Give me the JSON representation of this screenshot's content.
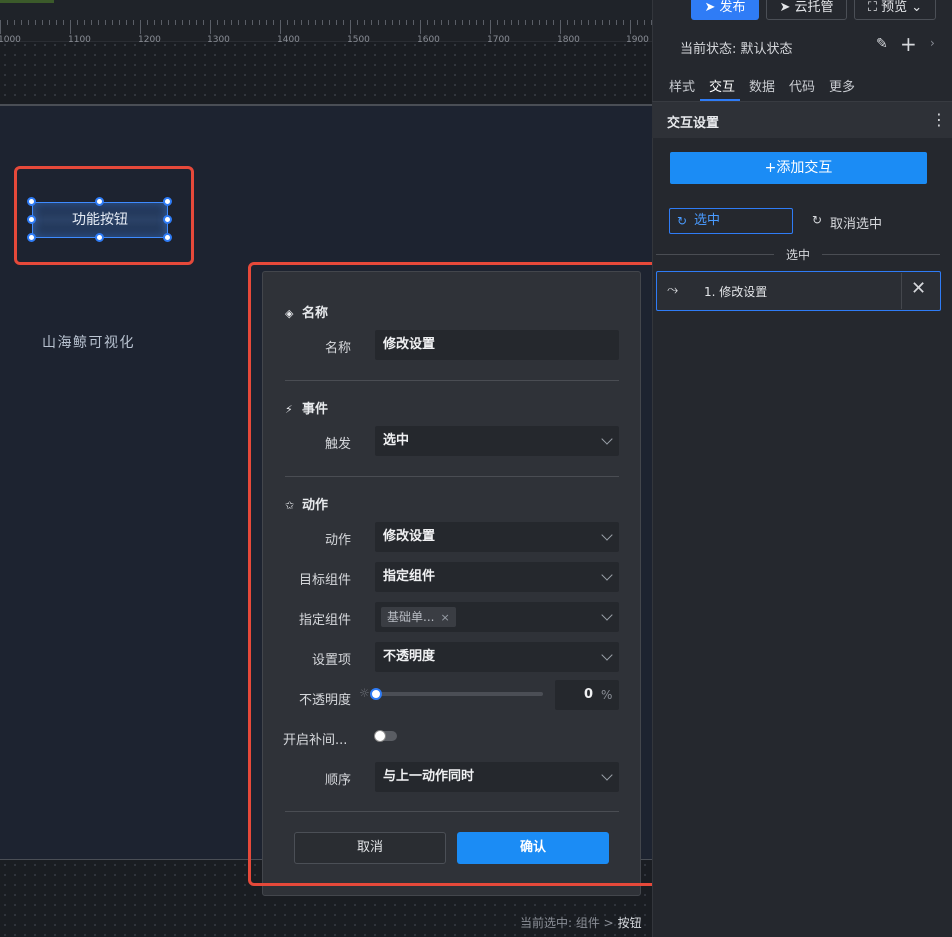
{
  "ruler": {
    "ticks": [
      "1000",
      "1100",
      "1200",
      "1300",
      "1400",
      "1500",
      "1600",
      "1700",
      "1800",
      "1900"
    ]
  },
  "canvas": {
    "button_label": "功能按钮",
    "brand_text": "山海鲸可视化",
    "selection_prefix": "当前选中: 组件 >",
    "selection_current": "按钮"
  },
  "toolbar": {
    "publish_label": "发布",
    "cloud_label": "云托管",
    "preview_label": "预览"
  },
  "panel": {
    "state_label": "当前状态:  默认状态",
    "tabs": [
      {
        "label": "样式"
      },
      {
        "label": "交互"
      },
      {
        "label": "数据"
      },
      {
        "label": "代码"
      },
      {
        "label": "更多"
      }
    ],
    "active_tab": "交互",
    "section_title": "交互设置",
    "add_button": "+添加交互",
    "option_select": "选中",
    "option_deselect": "取消选中",
    "group_label": "选中",
    "action_item": "1. 修改设置"
  },
  "dialog": {
    "name_section": "名称",
    "name_label": "名称",
    "name_value": "修改设置",
    "event_section": "事件",
    "trigger_label": "触发",
    "trigger_value": "选中",
    "action_section": "动作",
    "action_label": "动作",
    "action_value": "修改设置",
    "target_label": "目标组件",
    "target_value": "指定组件",
    "specified_label": "指定组件",
    "specified_tag": "基础单...",
    "setting_label": "设置项",
    "setting_value": "不透明度",
    "opacity_label": "不透明度",
    "opacity_value": "0",
    "opacity_unit": "%",
    "opacity_fraction": 0,
    "tween_label": "开启补间...",
    "tween_on": false,
    "order_label": "顺序",
    "order_value": "与上一动作同时",
    "cancel_label": "取消",
    "confirm_label": "确认"
  },
  "colors": {
    "accent": "#1b8cf5",
    "highlight_border": "#e6493a"
  }
}
